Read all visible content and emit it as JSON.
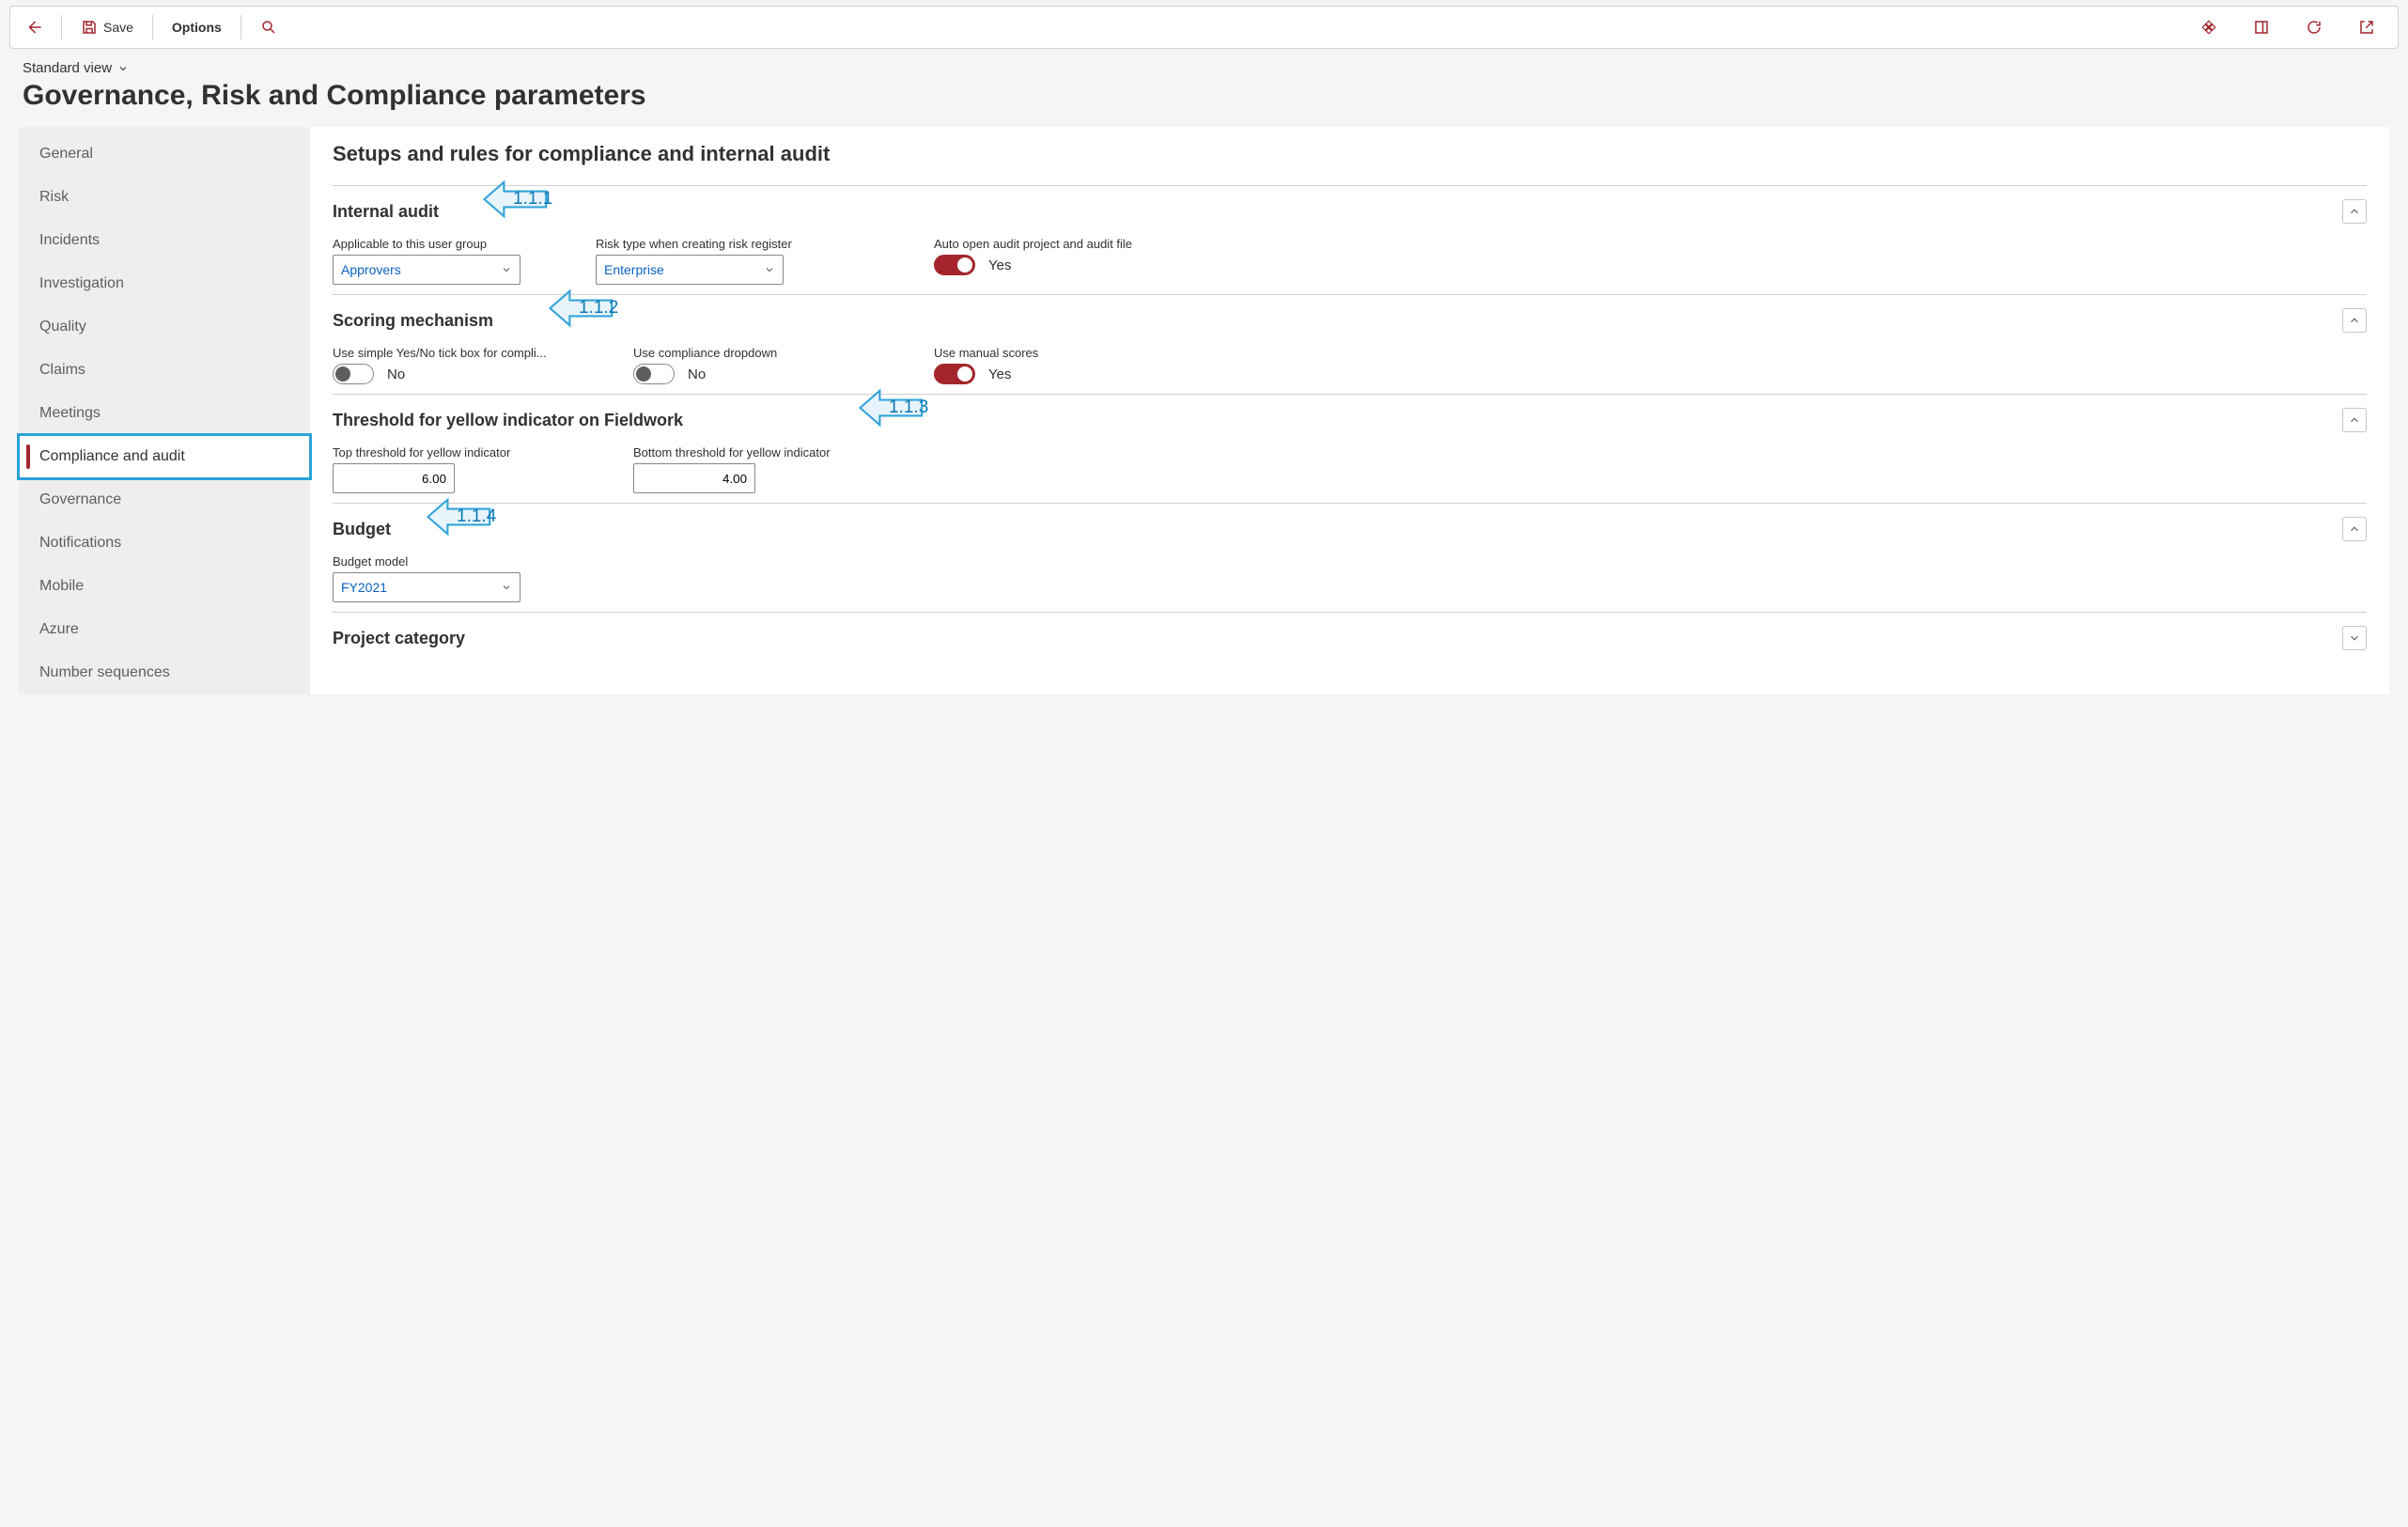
{
  "toolbar": {
    "save_label": "Save",
    "options_label": "Options"
  },
  "header": {
    "view_label": "Standard view",
    "page_title": "Governance, Risk and Compliance parameters"
  },
  "sidebar": {
    "items": [
      {
        "label": "General"
      },
      {
        "label": "Risk"
      },
      {
        "label": "Incidents"
      },
      {
        "label": "Investigation"
      },
      {
        "label": "Quality"
      },
      {
        "label": "Claims"
      },
      {
        "label": "Meetings"
      },
      {
        "label": "Compliance and audit"
      },
      {
        "label": "Governance"
      },
      {
        "label": "Notifications"
      },
      {
        "label": "Mobile"
      },
      {
        "label": "Azure"
      },
      {
        "label": "Number sequences"
      }
    ],
    "active_index": 7
  },
  "content": {
    "title": "Setups and rules for compliance and internal audit",
    "sections": {
      "internal_audit": {
        "title": "Internal audit",
        "annotation": "1.1.1",
        "fields": {
          "user_group_label": "Applicable to this user group",
          "user_group_value": "Approvers",
          "risk_type_label": "Risk type when creating risk register",
          "risk_type_value": "Enterprise",
          "auto_open_label": "Auto open audit project and audit file",
          "auto_open_value": "Yes",
          "auto_open_on": true
        }
      },
      "scoring": {
        "title": "Scoring mechanism",
        "annotation": "1.1.2",
        "fields": {
          "tickbox_label": "Use simple Yes/No tick box for compli...",
          "tickbox_value": "No",
          "dropdown_label": "Use compliance dropdown",
          "dropdown_value": "No",
          "manual_label": "Use manual scores",
          "manual_value": "Yes"
        }
      },
      "threshold": {
        "title": "Threshold for yellow indicator on Fieldwork",
        "annotation": "1.1.3",
        "fields": {
          "top_label": "Top threshold for yellow indicator",
          "top_value": "6.00",
          "bottom_label": "Bottom threshold for yellow indicator",
          "bottom_value": "4.00"
        }
      },
      "budget": {
        "title": "Budget",
        "annotation": "1.1.4",
        "fields": {
          "model_label": "Budget model",
          "model_value": "FY2021"
        }
      },
      "project_category": {
        "title": "Project category"
      }
    }
  }
}
